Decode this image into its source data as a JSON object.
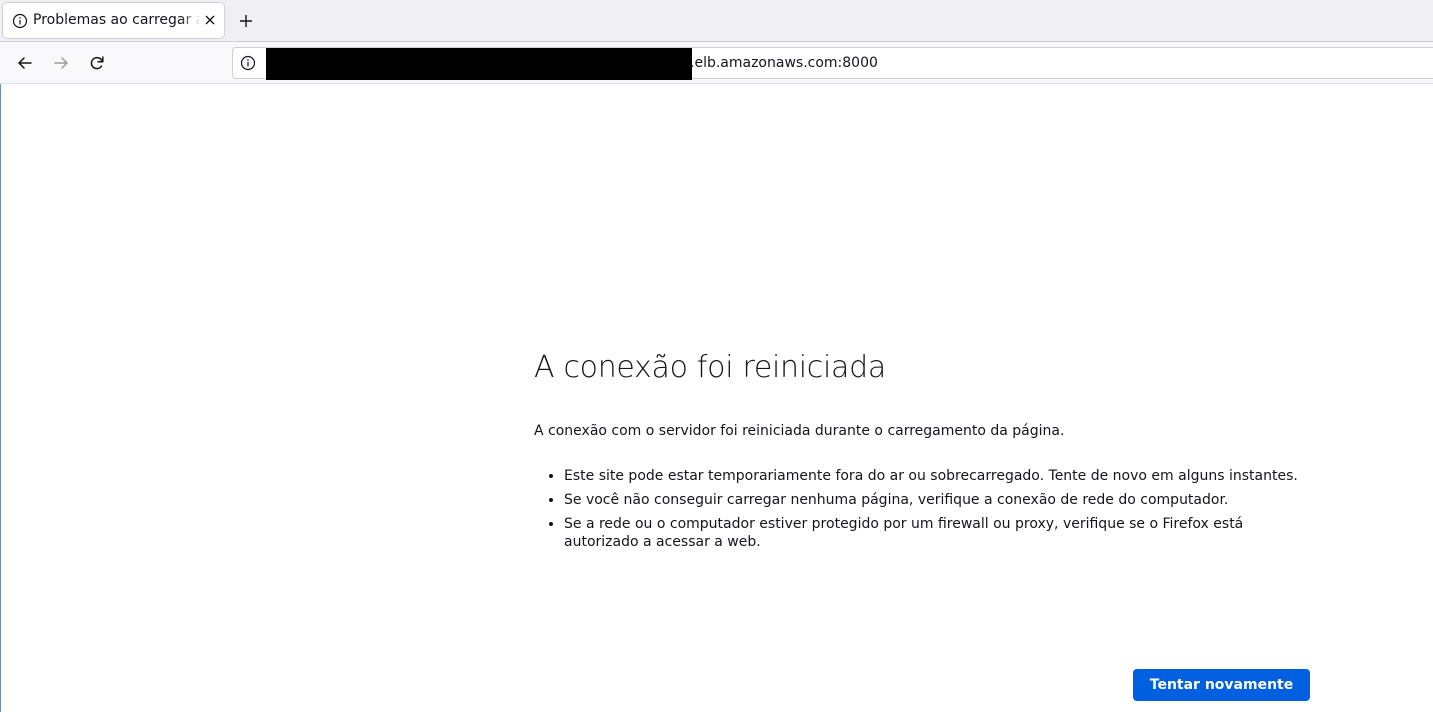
{
  "tab": {
    "title": "Problemas ao carregar a página",
    "icon": "info-icon",
    "close_icon": "close-icon"
  },
  "toolbar": {
    "new_tab_icon": "plus-icon",
    "back_icon": "arrow-left-icon",
    "forward_icon": "arrow-right-icon",
    "reload_icon": "reload-icon"
  },
  "url_bar": {
    "info_icon": "info-icon",
    "url_visible": ".elb.amazonaws.com:8000"
  },
  "error": {
    "title": "A conexão foi reiniciada",
    "description": "A conexão com o servidor foi reiniciada durante o carregamento da página.",
    "items": [
      "Este site pode estar temporariamente fora do ar ou sobrecarregado. Tente de novo em alguns instantes.",
      "Se você não conseguir carregar nenhuma página, verifique a conexão de rede do computador.",
      "Se a rede ou o computador estiver protegido por um firewall ou proxy, verifique se o Firefox está autorizado a acessar a web."
    ],
    "retry_label": "Tentar novamente"
  },
  "colors": {
    "accent": "#0060df",
    "text": "#15141a",
    "tab_strip": "#f0f0f4"
  }
}
